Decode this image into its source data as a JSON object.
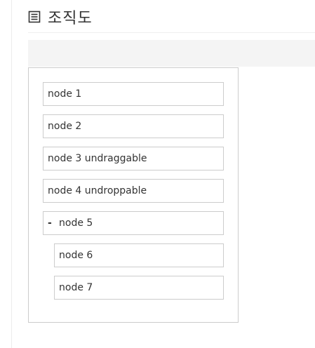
{
  "page": {
    "title": "조직도"
  },
  "tree": {
    "nodes": [
      {
        "label": "node 1"
      },
      {
        "label": "node 2"
      },
      {
        "label": "node 3 undraggable"
      },
      {
        "label": "node 4 undroppable"
      },
      {
        "label": "node 5",
        "toggle": "-"
      },
      {
        "label": "node 6"
      },
      {
        "label": "node 7"
      }
    ]
  },
  "colors": {
    "border": "#cccccc",
    "toolbar_bg": "#f4f4f4",
    "text": "#333333"
  },
  "icons": {
    "title_icon": "document-list-icon"
  }
}
